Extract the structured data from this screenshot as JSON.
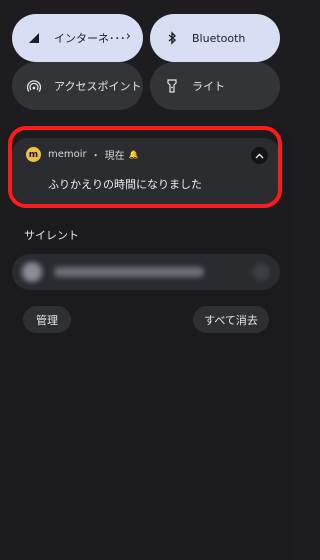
{
  "quick_settings": {
    "internet": {
      "label": "インターネ･･･",
      "icon": "signal-icon",
      "active": true
    },
    "bluetooth": {
      "label": "Bluetooth",
      "icon": "bluetooth-icon",
      "active": true
    },
    "hotspot": {
      "label": "アクセスポイント",
      "icon": "hotspot-icon",
      "active": false
    },
    "light": {
      "label": "ライト",
      "icon": "flashlight-icon",
      "active": false
    }
  },
  "notification": {
    "app_icon_letter": "m",
    "app_name": "memoir",
    "separator": "・",
    "time": "現在",
    "bell_icon": "🔔",
    "message": "ふりかえりの時間になりました",
    "highlight_color": "#ff1a1a"
  },
  "silent_section": {
    "label": "サイレント"
  },
  "actions": {
    "manage_label": "管理",
    "clear_all_label": "すべて消去"
  },
  "colors": {
    "tile_active": "#d8dff5",
    "tile_inactive": "#333438",
    "background": "#1d1d1f"
  }
}
